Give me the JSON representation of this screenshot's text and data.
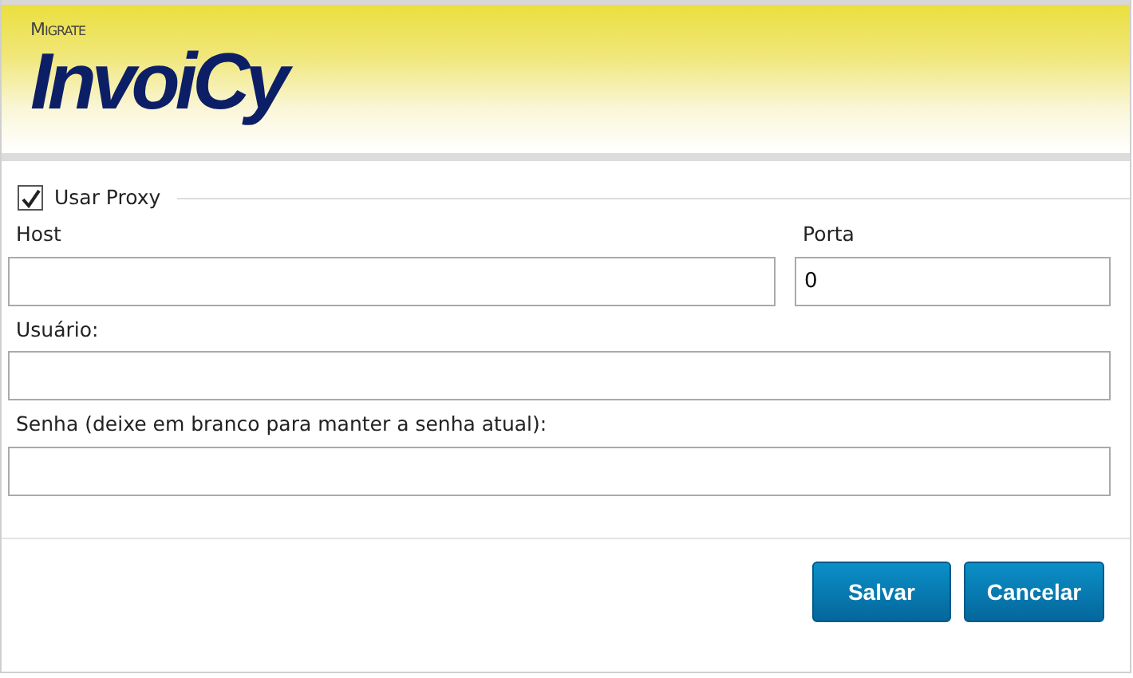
{
  "header": {
    "brand_small": "Migrate",
    "brand": "InvoiCy"
  },
  "proxy": {
    "label": "Usar Proxy",
    "checked": true
  },
  "fields": [
    {
      "label": "Host"
    },
    {
      "label": "Porta",
      "value": "0"
    },
    {
      "label": "Usuário:"
    },
    {
      "label": "Senha (deixe em branco para manter a senha atual):"
    }
  ],
  "buttons": [
    "Salvar",
    "Cancelar"
  ]
}
